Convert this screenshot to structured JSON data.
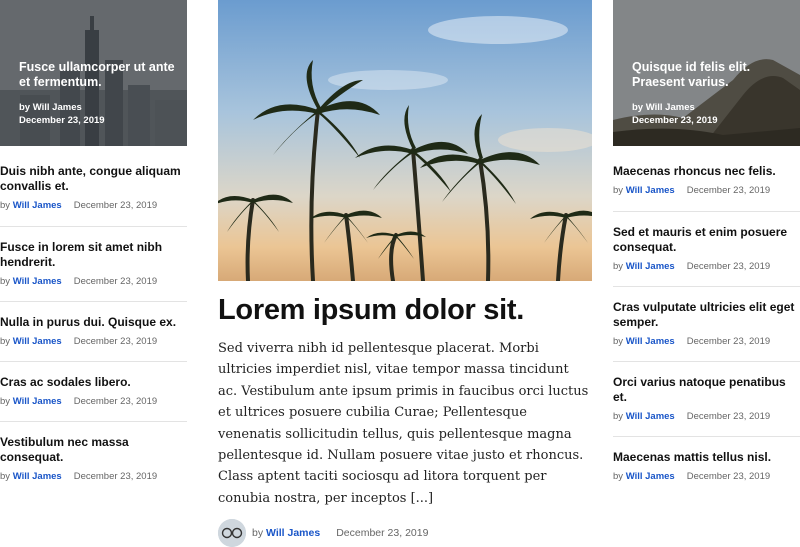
{
  "left": {
    "hero": {
      "title": "Fusce ullamcorper ut ante et fermentum.",
      "by_prefix": "by",
      "author": "Will James",
      "date": "December 23, 2019"
    },
    "items": [
      {
        "title": "Duis nibh ante, congue aliquam convallis et.",
        "by_prefix": "by",
        "author": "Will James",
        "date": "December 23, 2019"
      },
      {
        "title": "Fusce in lorem sit amet nibh hendrerit.",
        "by_prefix": "by",
        "author": "Will James",
        "date": "December 23, 2019"
      },
      {
        "title": "Nulla in purus dui. Quisque ex.",
        "by_prefix": "by",
        "author": "Will James",
        "date": "December 23, 2019"
      },
      {
        "title": "Cras ac sodales libero.",
        "by_prefix": "by",
        "author": "Will James",
        "date": "December 23, 2019"
      },
      {
        "title": "Vestibulum nec massa consequat.",
        "by_prefix": "by",
        "author": "Will James",
        "date": "December 23, 2019"
      }
    ]
  },
  "main": {
    "title": "Lorem ipsum dolor sit.",
    "excerpt": "Sed viverra nibh id pellentesque placerat. Morbi ultricies imperdiet nisl, vitae tempor massa tincidunt ac. Vestibulum ante ipsum primis in faucibus orci luctus et ultrices posuere cubilia Curae; Pellentesque venenatis sollicitudin tellus, quis pellentesque magna pellentesque id. Nullam posuere vitae justo et rhoncus. Class aptent taciti sociosqu ad litora torquent per conubia nostra, per inceptos [...]",
    "by_prefix": "by",
    "author": "Will James",
    "date": "December 23, 2019"
  },
  "right": {
    "hero": {
      "title": "Quisque id felis elit. Praesent varius.",
      "by_prefix": "by",
      "author": "Will James",
      "date": "December 23, 2019"
    },
    "items": [
      {
        "title": "Maecenas rhoncus nec felis.",
        "by_prefix": "by",
        "author": "Will James",
        "date": "December 23, 2019"
      },
      {
        "title": "Sed et mauris et enim posuere consequat.",
        "by_prefix": "by",
        "author": "Will James",
        "date": "December 23, 2019"
      },
      {
        "title": "Cras vulputate ultricies elit eget semper.",
        "by_prefix": "by",
        "author": "Will James",
        "date": "December 23, 2019"
      },
      {
        "title": "Orci varius natoque penatibus et.",
        "by_prefix": "by",
        "author": "Will James",
        "date": "December 23, 2019"
      },
      {
        "title": "Maecenas mattis tellus nisl.",
        "by_prefix": "by",
        "author": "Will James",
        "date": "December 23, 2019"
      }
    ]
  },
  "colors": {
    "author_link": "#1a56c8",
    "divider": "#e3e3e3"
  }
}
